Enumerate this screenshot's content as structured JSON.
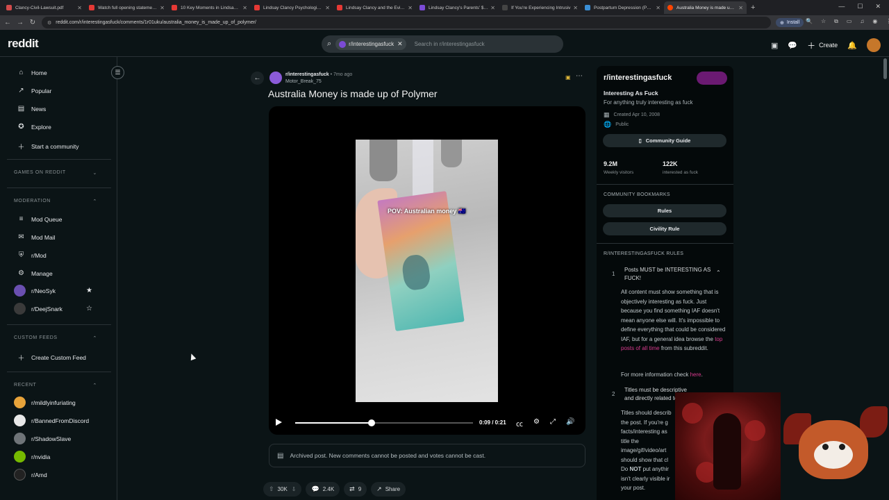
{
  "browser": {
    "tabs": [
      {
        "label": "Clancy-Civil-Lawsuit.pdf",
        "color": "#d24b4b"
      },
      {
        "label": "Watch full opening statements",
        "color": "#e53935"
      },
      {
        "label": "10 Key Moments in Lindsay Cla",
        "color": "#e53935"
      },
      {
        "label": "Lindsay Clancy Psychologist Di",
        "color": "#e53935"
      },
      {
        "label": "Lindsay Clancy and the Eviden",
        "color": "#e53935"
      },
      {
        "label": "Lindsay Clancy's Parents' $1 M",
        "color": "#7b4bd6"
      },
      {
        "label": "If You're Experiencing Intrusiv",
        "color": "#444444"
      },
      {
        "label": "Postpartum Depression (PPD)",
        "color": "#3a8fd6"
      },
      {
        "label": "Australia Money is made up of",
        "color": "#ff4500"
      }
    ],
    "new_tab": "+",
    "url": "reddit.com/r/interestingasfuck/comments/1r01uku/australia_money_is_made_up_of_polymer/",
    "install_label": "Install"
  },
  "header": {
    "logo": "reddit",
    "search_chip": "r/interestingasfuck",
    "search_placeholder": "Search in r/interestingasfuck",
    "create_label": "Create"
  },
  "sidebar": {
    "main_items": [
      {
        "label": "Home",
        "icon": "home-icon"
      },
      {
        "label": "Popular",
        "icon": "popular-icon"
      },
      {
        "label": "News",
        "icon": "news-icon"
      },
      {
        "label": "Explore",
        "icon": "explore-icon"
      },
      {
        "label": "Start a community",
        "icon": "plus-icon"
      }
    ],
    "games_heading": "GAMES ON REDDIT",
    "moderation_heading": "MODERATION",
    "moderation_items": [
      {
        "label": "Mod Queue"
      },
      {
        "label": "Mod Mail"
      },
      {
        "label": "r/Mod"
      },
      {
        "label": "Manage"
      },
      {
        "label": "r/NeoSyk"
      },
      {
        "label": "r/DeejSnark"
      }
    ],
    "custom_feeds_heading": "CUSTOM FEEDS",
    "create_custom_feed": "Create Custom Feed",
    "recent_heading": "RECENT",
    "recent_items": [
      {
        "label": "r/mildlyinfuriating",
        "color": "#e8a33a"
      },
      {
        "label": "r/BannedFromDiscord",
        "color": "#e8e8e8"
      },
      {
        "label": "r/ShadowSlave",
        "color": "#6f7478"
      },
      {
        "label": "r/nvidia",
        "color": "#76b900"
      },
      {
        "label": "r/Amd",
        "color": "#222222"
      }
    ]
  },
  "post": {
    "subreddit": "r/interestingasfuck",
    "age": "• 7mo ago",
    "author": "Motor_Break_75",
    "title": "Australia Money is made up of Polymer",
    "video_caption": "POV: Australian money 🇦🇺",
    "time": "0:09 / 0:21",
    "progress": 0.43,
    "archived_notice": "Archived post. New comments cannot be posted and votes cannot be cast.",
    "votes": "30K",
    "comments": "2.4K",
    "crossposts": "9",
    "share_label": "Share"
  },
  "community": {
    "title": "r/interestingasfuck",
    "name": "Interesting As Fuck",
    "description": "For anything truly interesting as fuck",
    "created": "Created Apr 10, 2008",
    "visibility": "Public",
    "guide_label": "Community Guide",
    "visitors": "9.2M",
    "visitors_label": "Weekly visitors",
    "members": "122K",
    "members_label": "interested as fuck",
    "bookmarks_heading": "COMMUNITY BOOKMARKS",
    "bookmarks": [
      "Rules",
      "Civility Rule"
    ],
    "rules_heading": "R/INTERESTINGASFUCK RULES",
    "rule1_num": "1",
    "rule1_title": "Posts MUST be INTERESTING AS FUCK!",
    "rule1_body": "All content must show something that is objectively interesting as fuck. Just because you find something IAF doesn't mean anyone else will. It's impossible to define everything that could be considered IAF, but for a general idea browse the",
    "rule1_link": "top posts of all time",
    "rule1_tail": "from this subreddit.",
    "rule1_more": "For more information check",
    "rule1_here": "here",
    "rule2_num": "2",
    "rule2_title": "Titles must be descriptive and directly related to t",
    "rule2_body_1": "Titles should describ",
    "rule2_body_2": "the post. If you're g",
    "rule2_body_3": "facts/interesting as",
    "rule2_body_4": "title the",
    "rule2_body_5": "image/gif/video/art",
    "rule2_body_6": "should show that cl",
    "rule2_body_7_pre": "Do ",
    "rule2_body_7_bold": "NOT",
    "rule2_body_7_post": " put anythir",
    "rule2_body_8": "isn't clearly visible ir",
    "rule2_body_9": "your post."
  }
}
